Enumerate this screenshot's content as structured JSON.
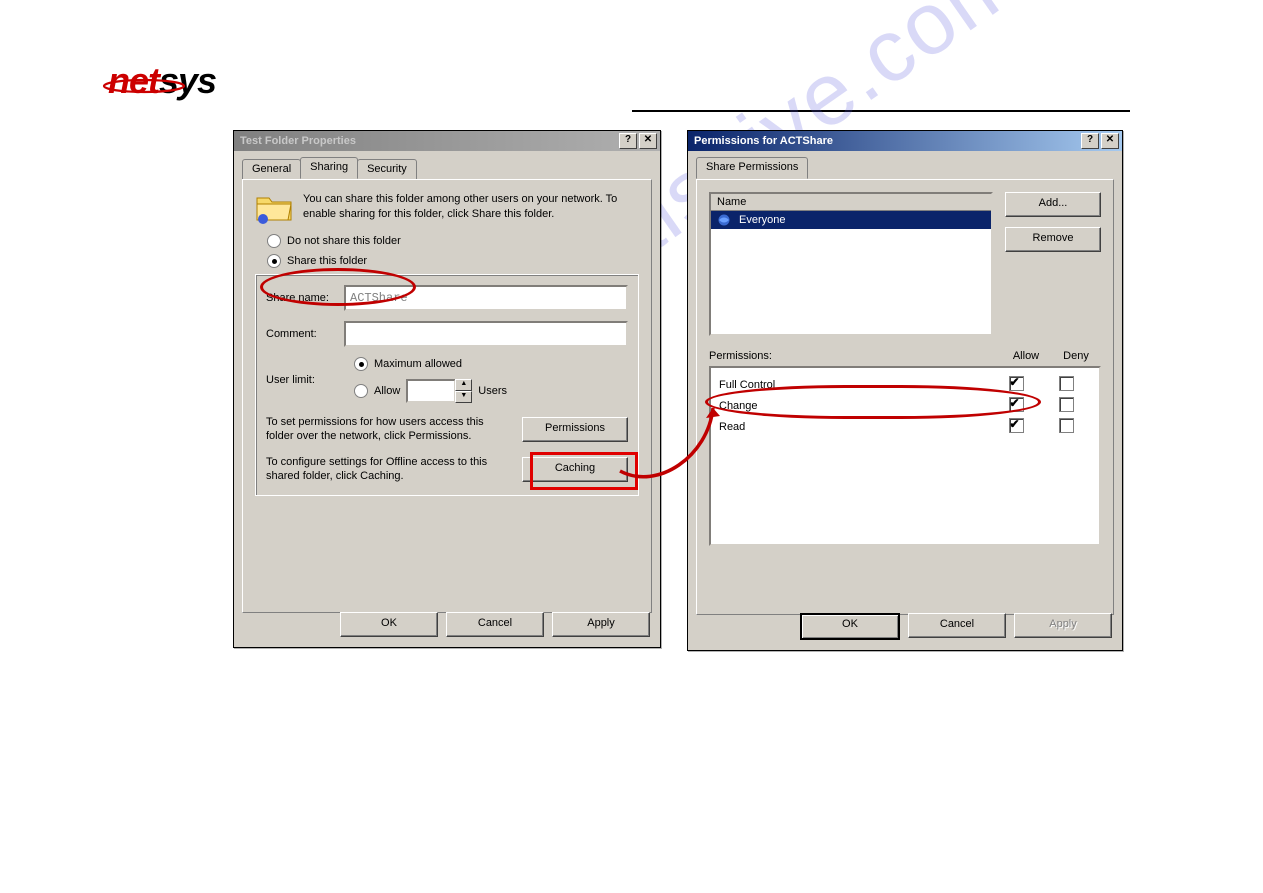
{
  "logo": {
    "net": "net",
    "sys": "sys"
  },
  "watermark": "manualshive.com",
  "dialog_left": {
    "title": "Test Folder Properties",
    "tabs": {
      "general": "General",
      "sharing": "Sharing",
      "security": "Security"
    },
    "intro": "You can share this folder among other users on your network.  To enable sharing for this folder, click Share this folder.",
    "radio_no_share": "Do not share this folder",
    "radio_share": "Share this folder",
    "share_name_label": "Share name:",
    "share_name_value": "ACTShare",
    "comment_label": "Comment:",
    "comment_value": "",
    "user_limit_label": "User limit:",
    "user_limit_max": "Maximum allowed",
    "user_limit_allow": "Allow",
    "user_limit_users": "Users",
    "perm_text": "To set permissions for how users access this folder over the network, click Permissions.",
    "perm_button": "Permissions",
    "caching_text": "To configure settings for Offline access to this shared folder, click Caching.",
    "caching_button": "Caching",
    "ok": "OK",
    "cancel": "Cancel",
    "apply": "Apply"
  },
  "dialog_right": {
    "title": "Permissions for ACTShare",
    "tab": "Share Permissions",
    "name_header": "Name",
    "entry_everyone": "Everyone",
    "add": "Add...",
    "remove": "Remove",
    "permissions_label": "Permissions:",
    "col_allow": "Allow",
    "col_deny": "Deny",
    "perm_full": "Full Control",
    "perm_change": "Change",
    "perm_read": "Read",
    "ok": "OK",
    "cancel": "Cancel",
    "apply": "Apply"
  },
  "titlebar_buttons": {
    "help": "?",
    "close": "✕"
  }
}
